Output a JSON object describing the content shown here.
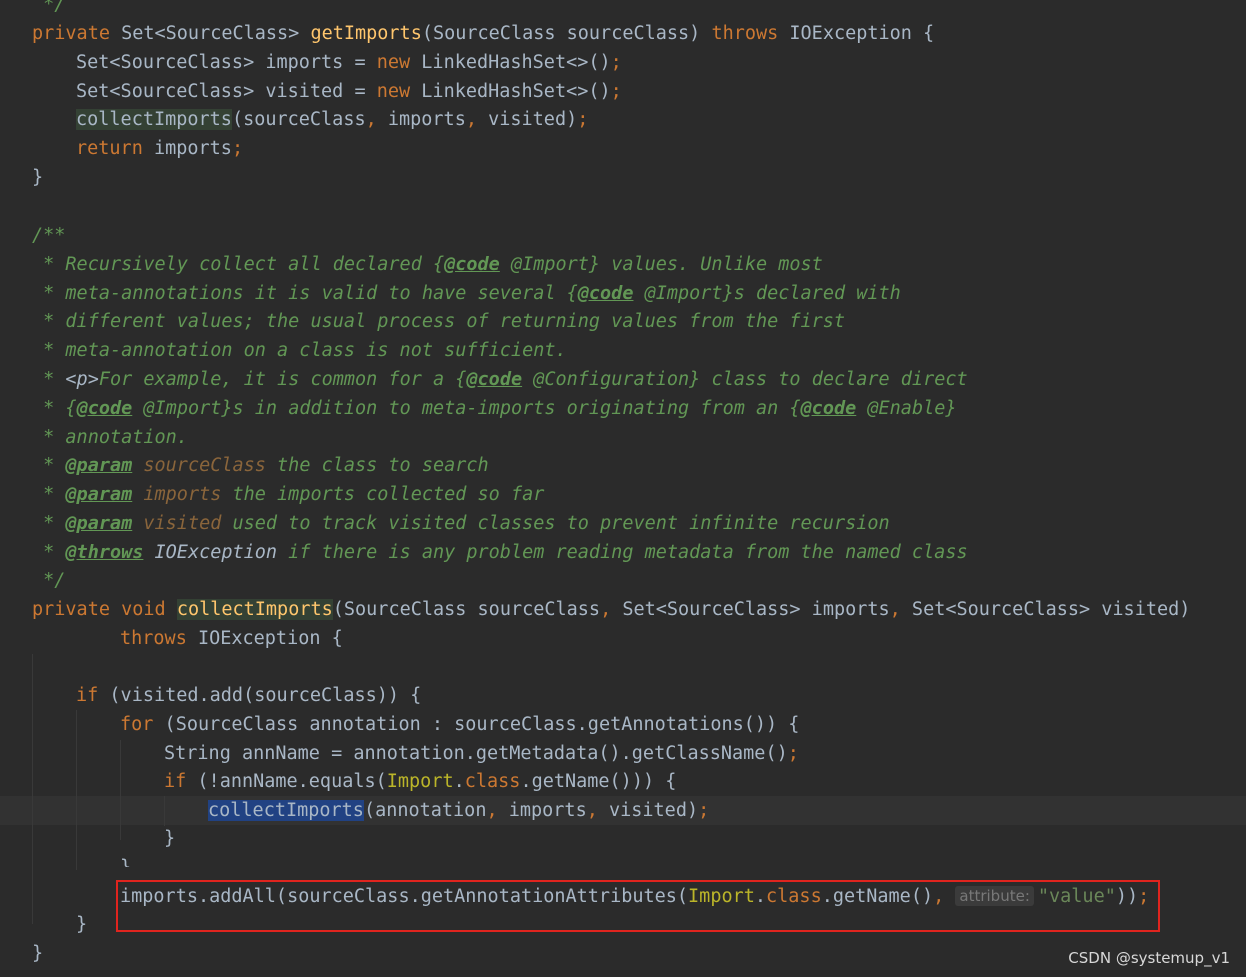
{
  "editor": {
    "comment_top": " */",
    "getImports_sig": {
      "private": "private",
      "ret": " Set<SourceClass> ",
      "name": "getImports",
      "params": "(SourceClass sourceClass) ",
      "throws": "throws",
      "exc": " IOException {"
    },
    "l_imports_decl": {
      "a": "Set<SourceClass> imports = ",
      "new": "new",
      "b": " LinkedHashSet<>()",
      "semi": ";"
    },
    "l_visited_decl": {
      "a": "Set<SourceClass> visited = ",
      "new": "new",
      "b": " LinkedHashSet<>()",
      "semi": ";"
    },
    "l_collect_call": {
      "name": "collectImports",
      "a": "(sourceClass",
      "c1": ",",
      "b": " imports",
      "c2": ",",
      "c": " visited)",
      "semi": ";"
    },
    "l_return": {
      "kw": "return",
      "a": " imports",
      "semi": ";"
    },
    "close_brace": "}",
    "javadoc": {
      "open": "/**",
      "l1": {
        "a": " * Recursively collect all declared {",
        "tag": "@code",
        "b": " @Import} values. Unlike most"
      },
      "l2": {
        "a": " * meta-annotations it is valid to have several {",
        "tag": "@code",
        "b": " @Import}s declared with"
      },
      "l3": " * different values; the usual process of returning values from the first",
      "l4": " * meta-annotation on a class is not sufficient.",
      "l5": {
        "a": " * ",
        "p": "<p>",
        "b": "For example, it is common for a {",
        "tag": "@code",
        "c": " @Configuration} class to declare direct"
      },
      "l6": {
        "a": " * {",
        "tag": "@code",
        "b": " @Import}s in addition to meta-imports originating from an {",
        "tag2": "@code",
        "c": " @Enable}"
      },
      "l7": " * annotation.",
      "p1": {
        "star": " * ",
        "tag": "@param",
        "name": " sourceClass",
        "desc": " the class to search"
      },
      "p2": {
        "star": " * ",
        "tag": "@param",
        "name": " imports",
        "desc": " the imports collected so far"
      },
      "p3": {
        "star": " * ",
        "tag": "@param",
        "name": " visited",
        "desc": " used to track visited classes to prevent infinite recursion"
      },
      "th": {
        "star": " * ",
        "tag": "@throws",
        "name": " IOException",
        "desc": " if there is any problem reading metadata from the named class"
      },
      "close": " */"
    },
    "collectImports_sig": {
      "private": "private",
      "void": "void",
      "name": "collectImports",
      "a": "(SourceClass sourceClass",
      "c1": ",",
      "b": " Set<SourceClass> imports",
      "c2": ",",
      "c": " Set<SourceClass> visited)"
    },
    "throws_line": {
      "kw": "throws",
      "a": " IOException {"
    },
    "if_line": {
      "kw": "if",
      "a": " (visited.add(sourceClass)) {"
    },
    "for_line": {
      "kw": "for",
      "a": " (SourceClass annotation : sourceClass.getAnnotations()) {"
    },
    "string_line": {
      "a": "String annName = annotation.getMetadata().getClassName()",
      "semi": ";"
    },
    "if2_line": {
      "kw": "if",
      "a": " (!annName.equals(",
      "cls": "Import",
      "dot": ".",
      "classkw": "class",
      "b": ".getName())) {"
    },
    "recurse_line": {
      "name": "collectImports",
      "a": "(annotation",
      "c1": ",",
      "b": " imports",
      "c2": ",",
      "c": " visited)",
      "semi": ";"
    },
    "addall_line": {
      "a": "imports.addAll(sourceClass.getAnnotationAttributes(",
      "cls": "Import",
      "dot": ".",
      "classkw": "class",
      "b": ".getName()",
      "comma": ",",
      "hint": "attribute:",
      "str": "\"value\"",
      "c": "))",
      "semi": ";"
    }
  },
  "watermark": "CSDN @systemup_v1"
}
